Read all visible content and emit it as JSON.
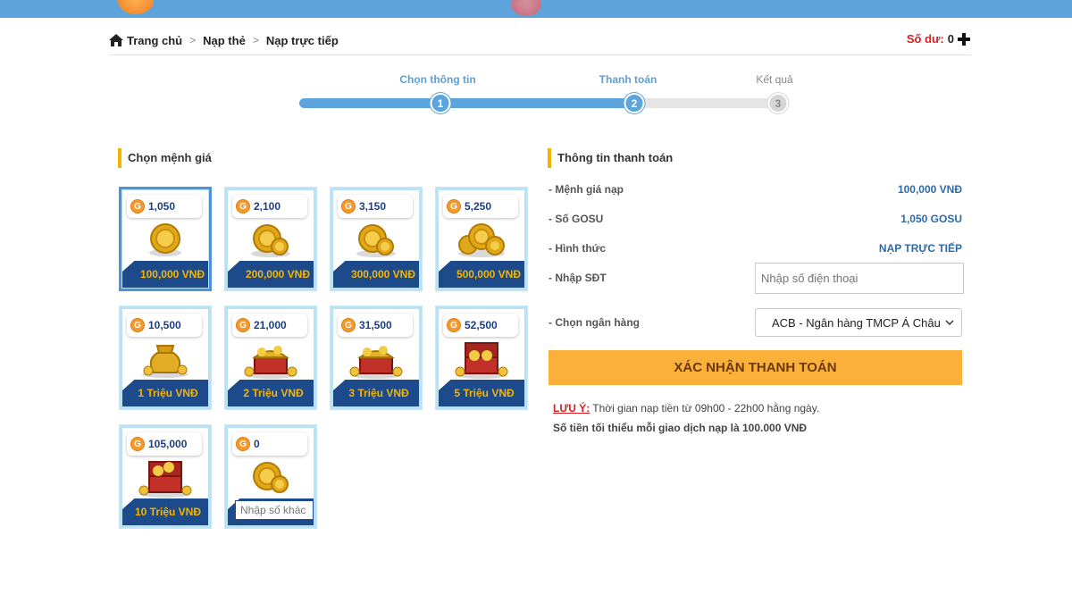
{
  "breadcrumb": {
    "home": "Trang chủ",
    "level2": "Nạp thẻ",
    "level3": "Nạp trực tiếp"
  },
  "balance": {
    "label": "Số dư:",
    "value": "0"
  },
  "steps": [
    {
      "label": "Chọn thông tin",
      "number": "1",
      "state": "done"
    },
    {
      "label": "Thanh toán",
      "number": "2",
      "state": "active"
    },
    {
      "label": "Kết quả",
      "number": "3",
      "state": "pending"
    }
  ],
  "left": {
    "title": "Chọn mệnh giá",
    "cards": [
      {
        "gosu": "1,050",
        "price": "100,000 VNĐ",
        "art": "coin-single"
      },
      {
        "gosu": "2,100",
        "price": "200,000 VNĐ",
        "art": "coin-double"
      },
      {
        "gosu": "3,150",
        "price": "300,000 VNĐ",
        "art": "coin-double"
      },
      {
        "gosu": "5,250",
        "price": "500,000 VNĐ",
        "art": "coin-triple"
      },
      {
        "gosu": "10,500",
        "price": "1 Triệu VNĐ",
        "art": "coin-sack"
      },
      {
        "gosu": "21,000",
        "price": "2 Triệu VNĐ",
        "art": "treasure-chest"
      },
      {
        "gosu": "31,500",
        "price": "3 Triệu VNĐ",
        "art": "treasure-chest"
      },
      {
        "gosu": "52,500",
        "price": "5 Triệu VNĐ",
        "art": "treasure-chest"
      },
      {
        "gosu": "105,000",
        "price": "10 Triệu VNĐ",
        "art": "treasure-chest"
      },
      {
        "gosu": "0",
        "custom_placeholder": "Nhập số khác",
        "art": "coin-double"
      }
    ]
  },
  "right": {
    "title": "Thông tin thanh toán",
    "rows": [
      {
        "key": "- Mệnh giá nạp",
        "value": "100,000 VNĐ"
      },
      {
        "key": "- Số GOSU",
        "value": "1,050 GOSU"
      },
      {
        "key": "- Hình thức",
        "value": "NẠP TRỰC TIẾP"
      }
    ],
    "phone_label": "- Nhập SĐT",
    "phone_placeholder": "Nhập số điện thoại",
    "bank_label": "- Chọn ngân hàng",
    "bank_selected": "ACB - Ngân hàng TMCP Á Châu",
    "confirm_label": "XÁC NHẬN THANH TOÁN",
    "note_warn": "LƯU Ý:",
    "note_text": "Thời gian nạp tiền từ 09h00 - 22h00 hằng ngày.",
    "note_min": "Số tiền tối thiểu mỗi giao dịch nạp là 100.000 VNĐ"
  },
  "colors": {
    "brand_blue": "#5ea4dc",
    "card_navy": "#1c4a8a",
    "accent_gold": "#f5b400",
    "button_orange": "#fbb03a",
    "warn_red": "#d81e1e"
  },
  "icons": {
    "home": "home-icon",
    "plus": "plus-icon",
    "gosu": "gosu-coin-icon",
    "chevron": "chevron-down-icon"
  }
}
